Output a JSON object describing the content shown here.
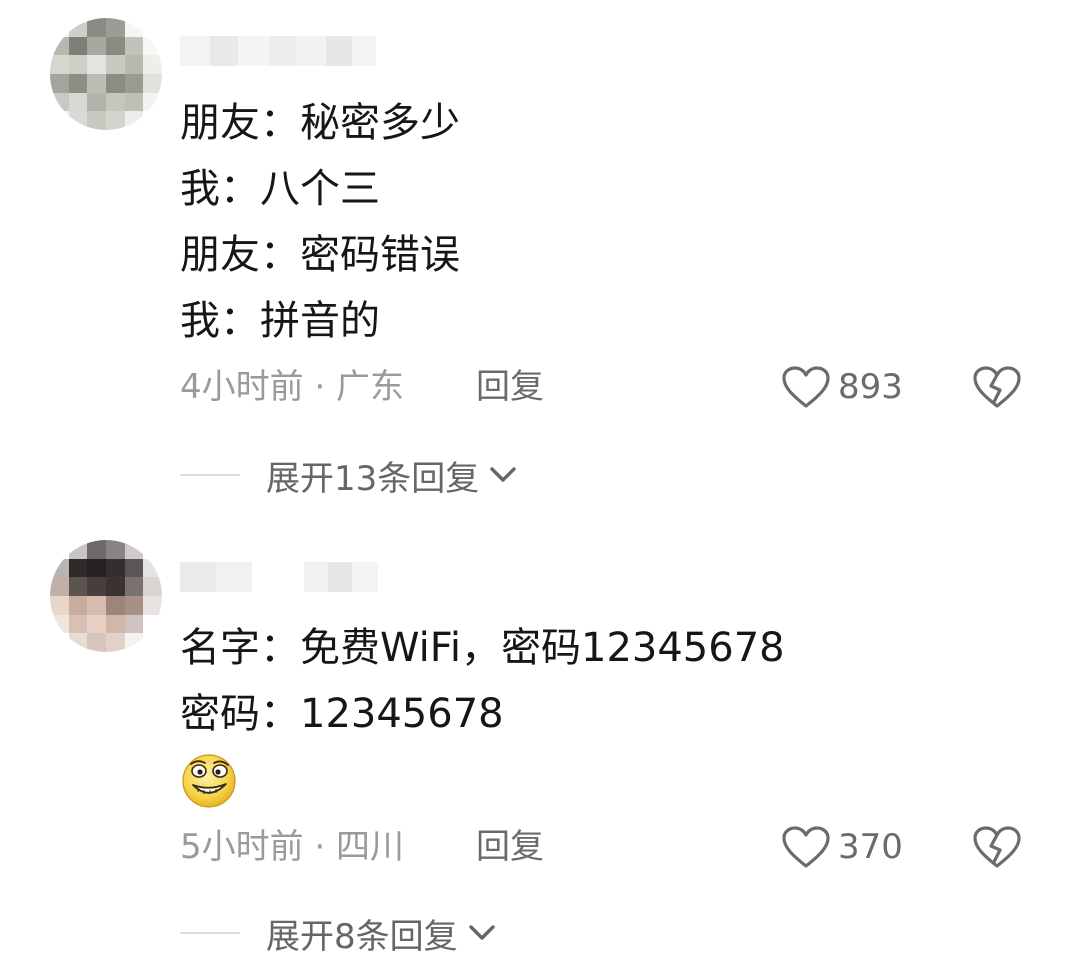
{
  "comments": [
    {
      "lines": [
        "朋友：秘密多少",
        "我：八个三",
        "朋友：密码错误",
        "我：拼音的"
      ],
      "time": "4小时前 · 广东",
      "reply_label": "回复",
      "likes": "893",
      "expand_label": "展开13条回复"
    },
    {
      "lines": [
        "名字：免费WiFi，密码12345678",
        "密码：12345678"
      ],
      "emoji_icon": "grinning-sly-face-emoji",
      "time": "5小时前 · 四川",
      "reply_label": "回复",
      "likes": "370",
      "expand_label": "展开8条回复"
    }
  ],
  "icons": {
    "like": "heart-outline-icon",
    "dislike": "broken-heart-icon",
    "expand": "chevron-down-icon"
  },
  "colors": {
    "text": "#161616",
    "meta": "#9a9a9a",
    "action": "#6b6b6b"
  }
}
